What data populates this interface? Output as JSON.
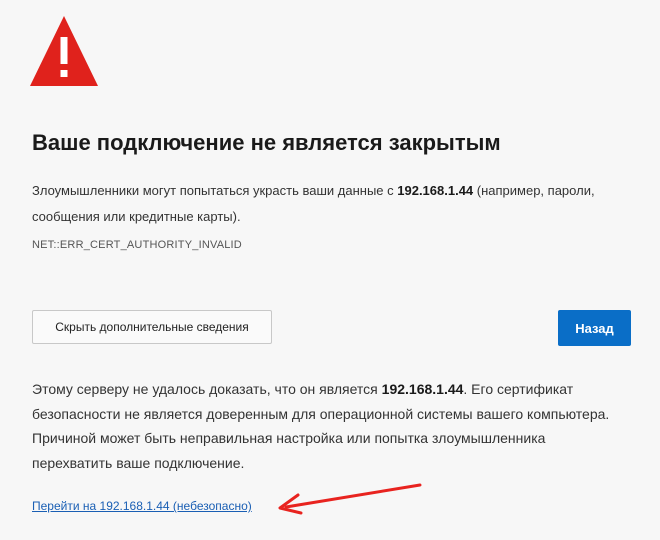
{
  "icons": {
    "warning": "warning-triangle-icon",
    "warning_color": "#e0221c",
    "annotation_arrow_color": "#e8231f"
  },
  "header": {
    "title": "Ваше подключение не является закрытым"
  },
  "description": {
    "prefix": "Злоумышленники могут попытаться украсть ваши данные с ",
    "host": "192.168.1.44",
    "suffix": " (например, пароли, сообщения или кредитные карты)."
  },
  "error_code": "NET::ERR_CERT_AUTHORITY_INVALID",
  "buttons": {
    "details_label": "Скрыть дополнительные сведения",
    "back_label": "Назад",
    "back_color": "#0a6ec7"
  },
  "details": {
    "prefix": "Этому серверу не удалось доказать, что он является ",
    "host": "192.168.1.44",
    "suffix": ". Его сертификат безопасности не является доверенным для операционной системы вашего компьютера. Причиной может быть неправильная настройка или попытка злоумышленника перехватить ваше подключение."
  },
  "proceed_link": "Перейти на 192.168.1.44 (небезопасно)"
}
